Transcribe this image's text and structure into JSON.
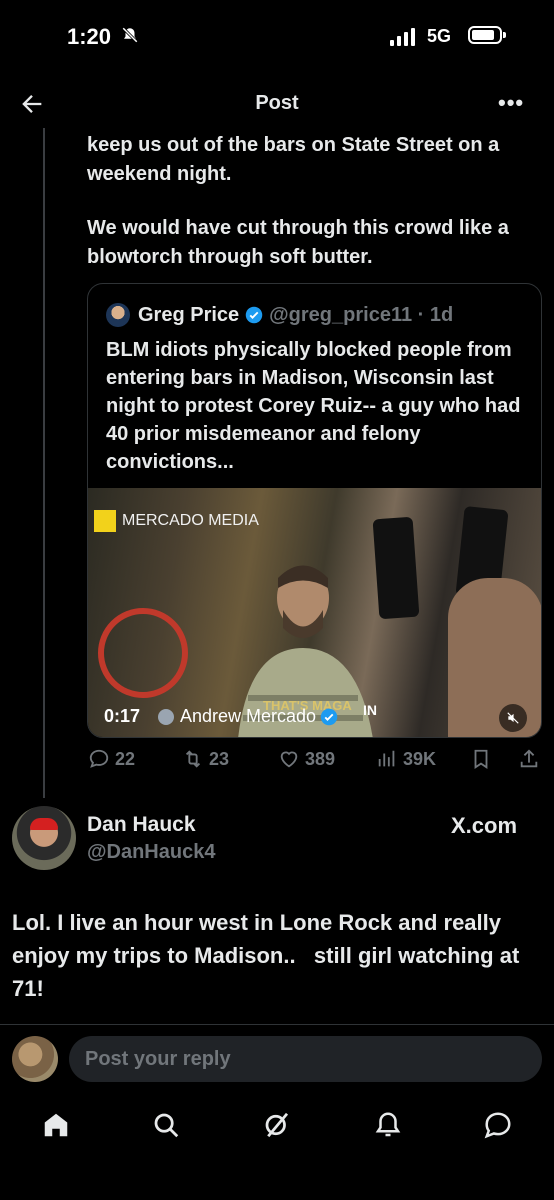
{
  "status_bar": {
    "time": "1:20",
    "network": "5G"
  },
  "header": {
    "title": "Post"
  },
  "post": {
    "paragraphs": [
      "keep us out of the bars on State Street on a weekend night.",
      "We would have cut through this crowd like a blowtorch through soft butter."
    ]
  },
  "quote": {
    "name": "Greg Price",
    "handle": "@greg_price11 · 1d",
    "text": "BLM idiots physically blocked people from entering bars in Madison, Wisconsin last night to protest Corey Ruiz-- a guy who had 40 prior misdemeanor and felony convictions...",
    "media": {
      "label": "MERCADO MEDIA",
      "duration": "0:17",
      "source": "Andrew Mercado",
      "watermark": "THAT'S MAGA",
      "overlay_in": "IN"
    }
  },
  "actions": {
    "replies": "22",
    "reposts": "23",
    "likes": "389",
    "views": "39K"
  },
  "reply": {
    "name": "Dan Hauck",
    "handle": "@DanHauck4",
    "source_mark": "X.com",
    "text": "Lol. I live an hour west in Lone Rock and really enjoy my trips to Madison..   still girl watching at 71!"
  },
  "composer": {
    "placeholder": "Post your reply"
  },
  "colors": {
    "background": "#000000",
    "text": "#e7e9ea",
    "muted": "#71767b",
    "verified": "#1d9bf0",
    "divider": "#2f3336"
  },
  "nav": {
    "icons": [
      "home-icon",
      "search-icon",
      "grok-icon",
      "notifications-icon",
      "messages-icon"
    ]
  }
}
